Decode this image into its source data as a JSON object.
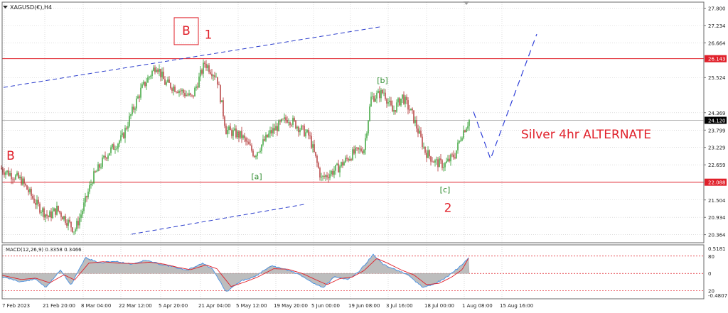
{
  "window": {
    "symbol_title": "XAGUSD(€),H4",
    "dropdown_icon": "triangle-down-icon",
    "scroll_marker_icon": "triangle-down-icon"
  },
  "colors": {
    "background": "#ffffff",
    "grid": "#c8c8c8",
    "bull_candle": "#2e9e2e",
    "bear_candle": "#b03030",
    "hline": "#e0202a",
    "channel": "#2a3ccc",
    "projection": "#3040d8",
    "wave_red": "#e0202a",
    "wave_green": "#2e8b2e",
    "price_badge": "#e0202a",
    "current_badge": "#000000",
    "macd_hist": "#bdbdbd",
    "macd_line": "#3b8eea",
    "signal_line": "#e0202a"
  },
  "chart_data": [
    {
      "type": "candlestick",
      "timeframe": "H4",
      "title": "Silver 4hr ALTERNATE",
      "x_tick_labels": [
        "7 Feb 2023",
        "21 Feb 20:00",
        "8 Mar 04:00",
        "22 Mar 12:00",
        "5 Apr 20:00",
        "21 Apr 04:00",
        "5 May 12:00",
        "19 May 20:00",
        "5 Jun 00:00",
        "19 Jun 08:00",
        "3 Jul 16:00",
        "18 Jul 00:00",
        "1 Aug 08:00",
        "15 Aug 16:00"
      ],
      "y_tick_labels": [
        "27.800",
        "27.234",
        "26.664",
        "25.524",
        "24.369",
        "23.799",
        "23.229",
        "22.659",
        "21.504",
        "20.934",
        "20.364"
      ],
      "ylim": [
        20.1,
        28.0
      ],
      "grid": true,
      "price_path": [
        {
          "x": 0,
          "y": 22.55
        },
        {
          "x": 30,
          "y": 22.15
        },
        {
          "x": 52,
          "y": 21.35
        },
        {
          "x": 68,
          "y": 20.95
        },
        {
          "x": 80,
          "y": 21.2
        },
        {
          "x": 95,
          "y": 20.8
        },
        {
          "x": 105,
          "y": 20.5
        },
        {
          "x": 115,
          "y": 21.1
        },
        {
          "x": 130,
          "y": 22.2
        },
        {
          "x": 150,
          "y": 23.0
        },
        {
          "x": 172,
          "y": 23.55
        },
        {
          "x": 185,
          "y": 24.35
        },
        {
          "x": 198,
          "y": 25.1
        },
        {
          "x": 220,
          "y": 25.95
        },
        {
          "x": 232,
          "y": 25.35
        },
        {
          "x": 250,
          "y": 25.15
        },
        {
          "x": 270,
          "y": 24.85
        },
        {
          "x": 288,
          "y": 26.0
        },
        {
          "x": 305,
          "y": 25.55
        },
        {
          "x": 318,
          "y": 23.8
        },
        {
          "x": 340,
          "y": 23.6
        },
        {
          "x": 358,
          "y": 23.0
        },
        {
          "x": 380,
          "y": 23.7
        },
        {
          "x": 405,
          "y": 24.2
        },
        {
          "x": 420,
          "y": 23.9
        },
        {
          "x": 435,
          "y": 23.6
        },
        {
          "x": 452,
          "y": 22.2
        },
        {
          "x": 475,
          "y": 22.55
        },
        {
          "x": 495,
          "y": 23.0
        },
        {
          "x": 512,
          "y": 23.2
        },
        {
          "x": 522,
          "y": 24.85
        },
        {
          "x": 540,
          "y": 25.05
        },
        {
          "x": 552,
          "y": 24.4
        },
        {
          "x": 566,
          "y": 24.9
        },
        {
          "x": 580,
          "y": 24.3
        },
        {
          "x": 598,
          "y": 23.1
        },
        {
          "x": 612,
          "y": 22.75
        },
        {
          "x": 625,
          "y": 22.65
        },
        {
          "x": 640,
          "y": 23.0
        },
        {
          "x": 650,
          "y": 23.7
        },
        {
          "x": 660,
          "y": 24.12
        }
      ],
      "horizontal_lines": [
        {
          "value": 26.143,
          "label": "26.143"
        },
        {
          "value": 22.088,
          "label": "22.088"
        }
      ],
      "current_price": {
        "value": 24.12,
        "label": "24.120"
      },
      "trend_channel": [
        {
          "from": {
            "x": 5,
            "y": 25.2
          },
          "to": {
            "x": 538,
            "y": 27.2
          }
        },
        {
          "from": {
            "x": 185,
            "y": 20.38
          },
          "to": {
            "x": 428,
            "y": 21.36
          }
        }
      ],
      "projection_path": [
        {
          "x": 666,
          "y": 24.4
        },
        {
          "x": 690,
          "y": 22.85
        },
        {
          "x": 755,
          "y": 26.95
        }
      ],
      "annotations": [
        {
          "text": "B",
          "boxed": true,
          "color": "red",
          "x": 262,
          "y": 27.07
        },
        {
          "text": "1",
          "boxed": false,
          "color": "red",
          "x": 293,
          "y": 26.94
        },
        {
          "text": "B",
          "boxed": false,
          "color": "red",
          "x": 15,
          "y": 22.96
        },
        {
          "text": "[a]",
          "boxed": false,
          "color": "green",
          "x": 361,
          "y": 22.28
        },
        {
          "text": "[b]",
          "boxed": false,
          "color": "green",
          "x": 538,
          "y": 25.43
        },
        {
          "text": "[c]",
          "boxed": false,
          "color": "green",
          "x": 626,
          "y": 21.85
        },
        {
          "text": "2",
          "boxed": false,
          "color": "red",
          "x": 630,
          "y": 21.25
        }
      ]
    },
    {
      "type": "area",
      "title": "MACD(12,26,9) 0.3358 0.3466",
      "y_tick_labels": [
        "0.5181",
        "80",
        "0",
        "20",
        "-0.4807"
      ],
      "ylim": [
        -0.4807,
        0.5181
      ],
      "series": [
        {
          "name": "MACD",
          "values": [
            {
              "x": 0,
              "y": -0.06
            },
            {
              "x": 30,
              "y": -0.18
            },
            {
              "x": 50,
              "y": -0.12
            },
            {
              "x": 65,
              "y": -0.3
            },
            {
              "x": 85,
              "y": 0.08
            },
            {
              "x": 100,
              "y": -0.25
            },
            {
              "x": 120,
              "y": 0.34
            },
            {
              "x": 140,
              "y": 0.22
            },
            {
              "x": 160,
              "y": 0.26
            },
            {
              "x": 185,
              "y": 0.2
            },
            {
              "x": 205,
              "y": 0.28
            },
            {
              "x": 225,
              "y": 0.2
            },
            {
              "x": 245,
              "y": 0.14
            },
            {
              "x": 262,
              "y": 0.06
            },
            {
              "x": 285,
              "y": 0.22
            },
            {
              "x": 300,
              "y": 0.08
            },
            {
              "x": 318,
              "y": -0.4
            },
            {
              "x": 340,
              "y": -0.15
            },
            {
              "x": 358,
              "y": -0.08
            },
            {
              "x": 380,
              "y": 0.16
            },
            {
              "x": 400,
              "y": 0.1
            },
            {
              "x": 420,
              "y": -0.02
            },
            {
              "x": 440,
              "y": -0.2
            },
            {
              "x": 455,
              "y": -0.3
            },
            {
              "x": 470,
              "y": -0.08
            },
            {
              "x": 490,
              "y": -0.12
            },
            {
              "x": 505,
              "y": 0.04
            },
            {
              "x": 525,
              "y": 0.4
            },
            {
              "x": 540,
              "y": 0.18
            },
            {
              "x": 560,
              "y": 0.06
            },
            {
              "x": 575,
              "y": -0.05
            },
            {
              "x": 595,
              "y": -0.3
            },
            {
              "x": 612,
              "y": -0.22
            },
            {
              "x": 628,
              "y": -0.08
            },
            {
              "x": 645,
              "y": 0.12
            },
            {
              "x": 660,
              "y": 0.34
            }
          ]
        },
        {
          "name": "Signal",
          "values": [
            {
              "x": 0,
              "y": -0.03
            },
            {
              "x": 30,
              "y": -0.13
            },
            {
              "x": 50,
              "y": -0.1
            },
            {
              "x": 70,
              "y": -0.2
            },
            {
              "x": 90,
              "y": -0.03
            },
            {
              "x": 105,
              "y": -0.14
            },
            {
              "x": 125,
              "y": 0.22
            },
            {
              "x": 145,
              "y": 0.25
            },
            {
              "x": 165,
              "y": 0.22
            },
            {
              "x": 190,
              "y": 0.21
            },
            {
              "x": 210,
              "y": 0.24
            },
            {
              "x": 230,
              "y": 0.2
            },
            {
              "x": 250,
              "y": 0.13
            },
            {
              "x": 268,
              "y": 0.08
            },
            {
              "x": 290,
              "y": 0.18
            },
            {
              "x": 305,
              "y": 0.1
            },
            {
              "x": 325,
              "y": -0.28
            },
            {
              "x": 345,
              "y": -0.18
            },
            {
              "x": 362,
              "y": -0.08
            },
            {
              "x": 385,
              "y": 0.1
            },
            {
              "x": 405,
              "y": 0.09
            },
            {
              "x": 425,
              "y": 0.0
            },
            {
              "x": 445,
              "y": -0.14
            },
            {
              "x": 460,
              "y": -0.24
            },
            {
              "x": 478,
              "y": -0.11
            },
            {
              "x": 495,
              "y": -0.08
            },
            {
              "x": 512,
              "y": 0.06
            },
            {
              "x": 530,
              "y": 0.32
            },
            {
              "x": 545,
              "y": 0.22
            },
            {
              "x": 565,
              "y": 0.07
            },
            {
              "x": 582,
              "y": -0.03
            },
            {
              "x": 600,
              "y": -0.24
            },
            {
              "x": 618,
              "y": -0.21
            },
            {
              "x": 635,
              "y": -0.08
            },
            {
              "x": 650,
              "y": 0.08
            },
            {
              "x": 660,
              "y": 0.35
            }
          ]
        }
      ]
    }
  ]
}
